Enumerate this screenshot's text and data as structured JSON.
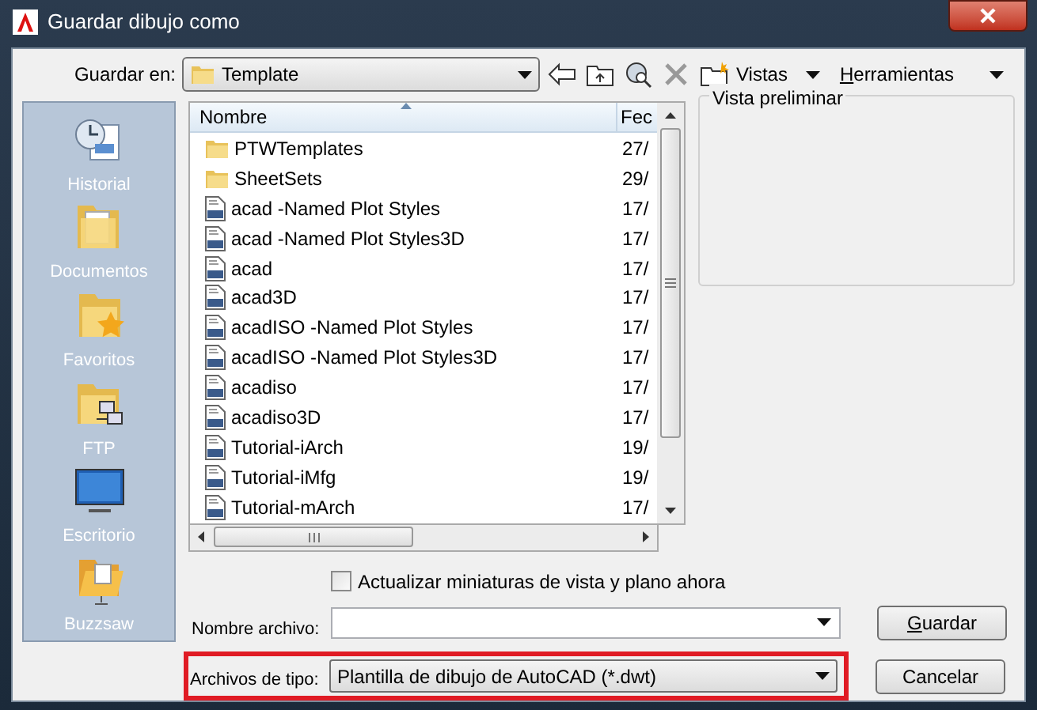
{
  "window": {
    "title": "Guardar dibujo como"
  },
  "toolbar": {
    "save_in_label": "Guardar en:",
    "location": "Template",
    "views_menu": "Vistas",
    "tools_menu": "Herramientas"
  },
  "places": [
    {
      "label": "Historial",
      "kind": "history"
    },
    {
      "label": "Documentos",
      "kind": "documents"
    },
    {
      "label": "Favoritos",
      "kind": "favorites"
    },
    {
      "label": "FTP",
      "kind": "ftp"
    },
    {
      "label": "Escritorio",
      "kind": "desktop"
    },
    {
      "label": "Buzzsaw",
      "kind": "buzzsaw"
    }
  ],
  "file_list": {
    "columns": [
      "Nombre",
      "Fec"
    ],
    "rows": [
      {
        "name": "PTWTemplates",
        "date": "27/",
        "kind": "folder"
      },
      {
        "name": "SheetSets",
        "date": "29/",
        "kind": "folder"
      },
      {
        "name": "acad -Named Plot Styles",
        "date": "17/",
        "kind": "dwt"
      },
      {
        "name": "acad -Named Plot Styles3D",
        "date": "17/",
        "kind": "dwt"
      },
      {
        "name": "acad",
        "date": "17/",
        "kind": "dwt"
      },
      {
        "name": "acad3D",
        "date": "17/",
        "kind": "dwt"
      },
      {
        "name": "acadISO -Named Plot Styles",
        "date": "17/",
        "kind": "dwt"
      },
      {
        "name": "acadISO -Named Plot Styles3D",
        "date": "17/",
        "kind": "dwt"
      },
      {
        "name": "acadiso",
        "date": "17/",
        "kind": "dwt"
      },
      {
        "name": "acadiso3D",
        "date": "17/",
        "kind": "dwt"
      },
      {
        "name": "Tutorial-iArch",
        "date": "19/",
        "kind": "dwt"
      },
      {
        "name": "Tutorial-iMfg",
        "date": "19/",
        "kind": "dwt"
      },
      {
        "name": "Tutorial-mArch",
        "date": "17/",
        "kind": "dwt"
      }
    ]
  },
  "preview": {
    "title": "Vista preliminar"
  },
  "update_thumbnails": {
    "label": "Actualizar miniaturas de vista y plano ahora",
    "checked": false
  },
  "file_name": {
    "label": "Nombre archivo:"
  },
  "file_type": {
    "label": "Archivos de tipo:",
    "value": "Plantilla de dibujo de AutoCAD (*.dwt)"
  },
  "buttons": {
    "save": "Guardar",
    "cancel": "Cancelar"
  }
}
